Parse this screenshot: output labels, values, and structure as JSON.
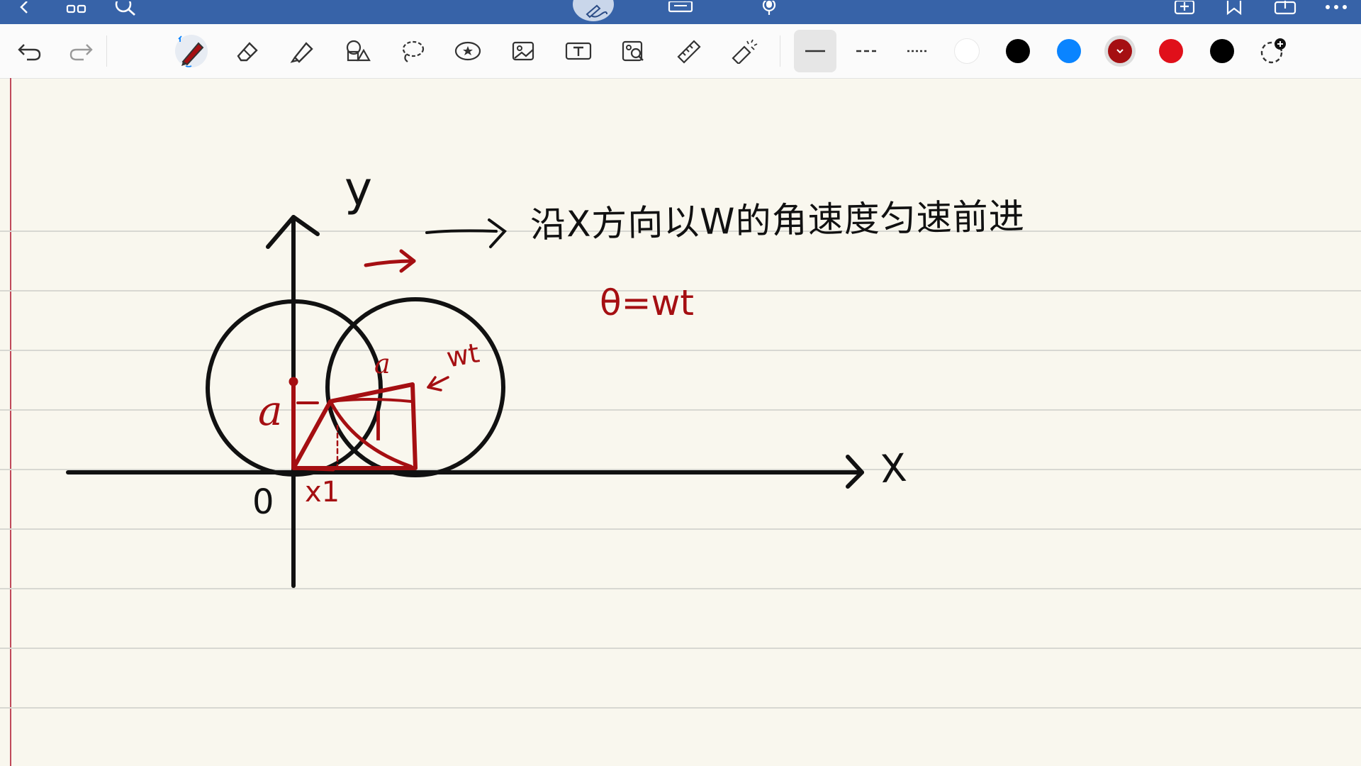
{
  "topbar": {
    "color": "#3763a8",
    "icons": [
      "back-chevron-icon",
      "grid-icon",
      "search-icon",
      "pen-mode-icon",
      "keyboard-icon",
      "microphone-icon",
      "add-page-icon",
      "bookmark-icon",
      "share-icon",
      "more-icon"
    ]
  },
  "toolbar": {
    "tools": [
      "undo-icon",
      "redo-icon",
      "pen-icon",
      "eraser-icon",
      "highlighter-icon",
      "shapes-icon",
      "lasso-icon",
      "sticker-icon",
      "image-icon",
      "text-icon",
      "photo-search-icon",
      "ruler-icon",
      "laser-pointer-icon"
    ],
    "active_tool": "pen-icon",
    "line_styles": [
      "solid",
      "dashed",
      "dotted"
    ],
    "active_line_style": "solid",
    "colors": [
      "#ffffff",
      "#000000",
      "#0a84ff",
      "#a50f12",
      "#e0101a",
      "#000000"
    ],
    "selected_color": "#a50f12"
  },
  "note": {
    "background": "#f9f7ee",
    "ink_black": "#111111",
    "ink_red": "#a50f12",
    "text_y_axis": "y",
    "text_x_axis": "X",
    "text_origin": "0",
    "text_heading": "沿X方向以W的角速度匀速前进",
    "text_theta": "θ=wt",
    "text_a_left": "a",
    "text_a_top": "a",
    "text_wt": "wt",
    "text_l": "l",
    "text_x1": "x1"
  }
}
